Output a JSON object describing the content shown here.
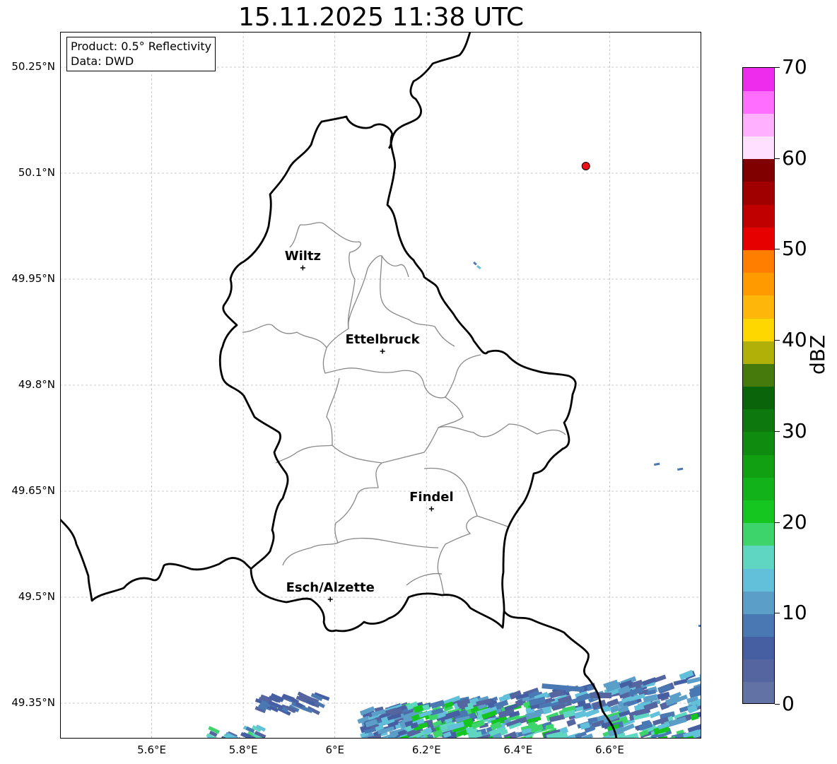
{
  "title": "15.11.2025 11:38 UTC",
  "info_box": {
    "product": "Product: 0.5° Reflectivity",
    "data": "Data: DWD"
  },
  "map": {
    "lon_range": [
      5.4,
      6.8
    ],
    "lat_range": [
      49.3,
      50.3
    ],
    "lat_ticks": [
      {
        "value": 50.25,
        "label": "50.25°N"
      },
      {
        "value": 50.1,
        "label": "50.1°N"
      },
      {
        "value": 49.95,
        "label": "49.95°N"
      },
      {
        "value": 49.8,
        "label": "49.8°N"
      },
      {
        "value": 49.65,
        "label": "49.65°N"
      },
      {
        "value": 49.5,
        "label": "49.5°N"
      },
      {
        "value": 49.35,
        "label": "49.35°N"
      }
    ],
    "lon_ticks": [
      {
        "value": 5.6,
        "label": "5.6°E"
      },
      {
        "value": 5.8,
        "label": "5.8°E"
      },
      {
        "value": 6.0,
        "label": "6°E"
      },
      {
        "value": 6.2,
        "label": "6.2°E"
      },
      {
        "value": 6.4,
        "label": "6.4°E"
      },
      {
        "value": 6.6,
        "label": "6.6°E"
      }
    ],
    "cities": [
      {
        "name": "Wiltz",
        "lon": 5.93,
        "lat": 49.966
      },
      {
        "name": "Ettelbruck",
        "lon": 6.104,
        "lat": 49.848
      },
      {
        "name": "Findel",
        "lon": 6.211,
        "lat": 49.625
      },
      {
        "name": "Esch/Alzette",
        "lon": 5.99,
        "lat": 49.497
      }
    ],
    "radar_site": {
      "lon": 6.548,
      "lat": 50.11,
      "color": "#e8141a"
    }
  },
  "colorbar": {
    "label": "dBZ",
    "min": 0,
    "max": 70,
    "ticks": [
      {
        "value": 0,
        "label": "0"
      },
      {
        "value": 10,
        "label": "10"
      },
      {
        "value": 20,
        "label": "20"
      },
      {
        "value": 30,
        "label": "30"
      },
      {
        "value": 40,
        "label": "40"
      },
      {
        "value": 50,
        "label": "50"
      },
      {
        "value": 60,
        "label": "60"
      },
      {
        "value": 70,
        "label": "70"
      }
    ],
    "colors": [
      "#6272a4",
      "#5565a0",
      "#465fa3",
      "#4a78b2",
      "#5b9ec8",
      "#62c0db",
      "#5fd6c2",
      "#3ed46c",
      "#14c61f",
      "#12b21a",
      "#11a011",
      "#0f8c0f",
      "#0d780d",
      "#0a640a",
      "#467a0c",
      "#b0b008",
      "#ffd700",
      "#ffb60a",
      "#ff9a00",
      "#ff7e00",
      "#e60000",
      "#c00000",
      "#a00000",
      "#800000",
      "#ffe0ff",
      "#ffb0ff",
      "#ff6eff",
      "#ee2cee"
    ]
  }
}
